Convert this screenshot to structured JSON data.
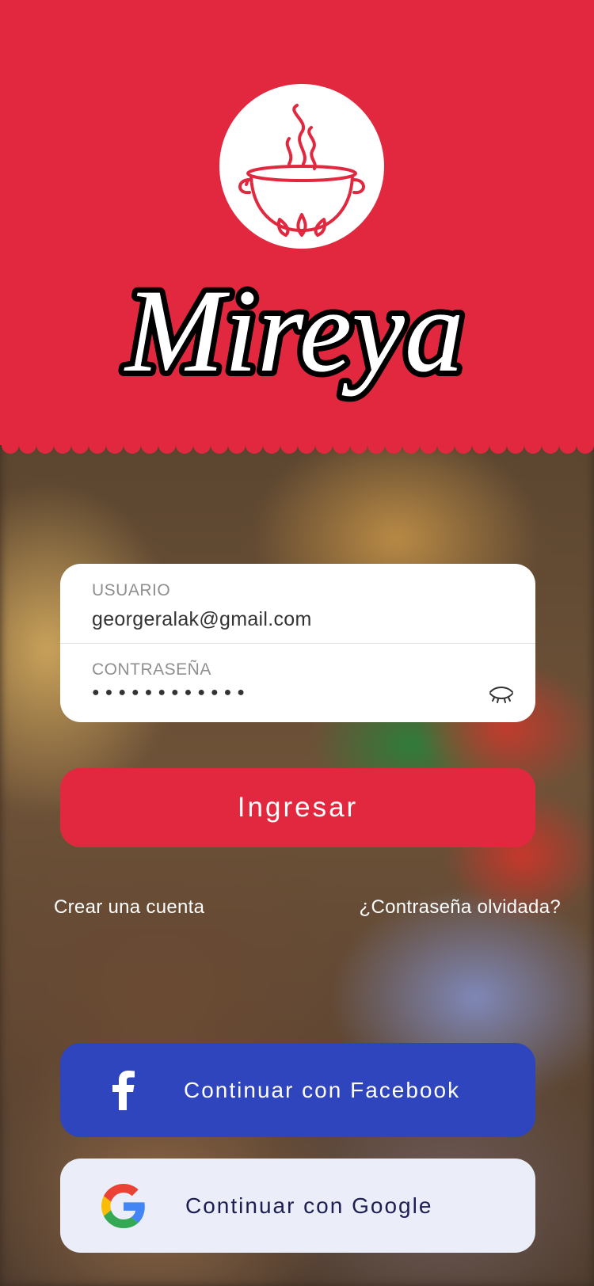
{
  "brand": {
    "name": "Mireya",
    "primary_color": "#e2283f",
    "logo_icon": "cooking-pot-icon"
  },
  "login_form": {
    "username": {
      "label": "USUARIO",
      "value": "georgeralak@gmail.com"
    },
    "password": {
      "label": "CONTRASEÑA",
      "masked_value": "●●●●●●●●●●●●",
      "toggle_icon": "eye-closed-icon"
    },
    "submit_label": "Ingresar"
  },
  "links": {
    "create_account": "Crear una cuenta",
    "forgot_password": "¿Contraseña olvidada?"
  },
  "social": {
    "facebook": {
      "label": "Continuar con Facebook",
      "icon": "facebook-icon",
      "color": "#2f45be"
    },
    "google": {
      "label": "Continuar con Google",
      "icon": "google-icon",
      "color": "#ebedf8"
    }
  }
}
